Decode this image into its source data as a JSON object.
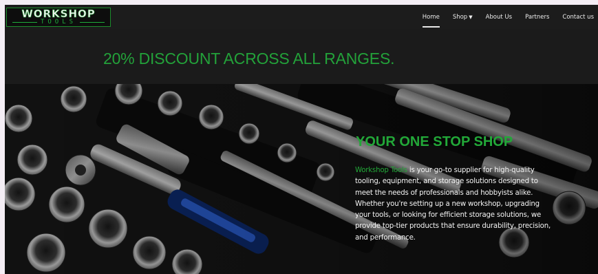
{
  "header": {
    "logo": {
      "main": "WORKSHOP",
      "sub": "TOOLS"
    },
    "nav": [
      {
        "label": "Home",
        "active": true
      },
      {
        "label": "Shop",
        "dropdown": true
      },
      {
        "label": "About Us"
      },
      {
        "label": "Partners"
      },
      {
        "label": "Contact us"
      }
    ]
  },
  "promo": {
    "text": "20% DISCOUNT ACROSS ALL RANGES."
  },
  "hero": {
    "title": "YOUR ONE STOP SHOP",
    "brand": "Workshop Tools",
    "body": " is your go-to supplier for high-quality tooling, equipment, and storage solutions designed to meet the needs of professionals and hobbyists alike. Whether you're setting up a new workshop, upgrading your tools, or looking for efficient storage solutions, we provide top-tier products that ensure durability, precision, and performance."
  },
  "colors": {
    "accent_green": "#22a838",
    "background_dark": "#1b1b1b",
    "nav_text": "#ececec"
  }
}
